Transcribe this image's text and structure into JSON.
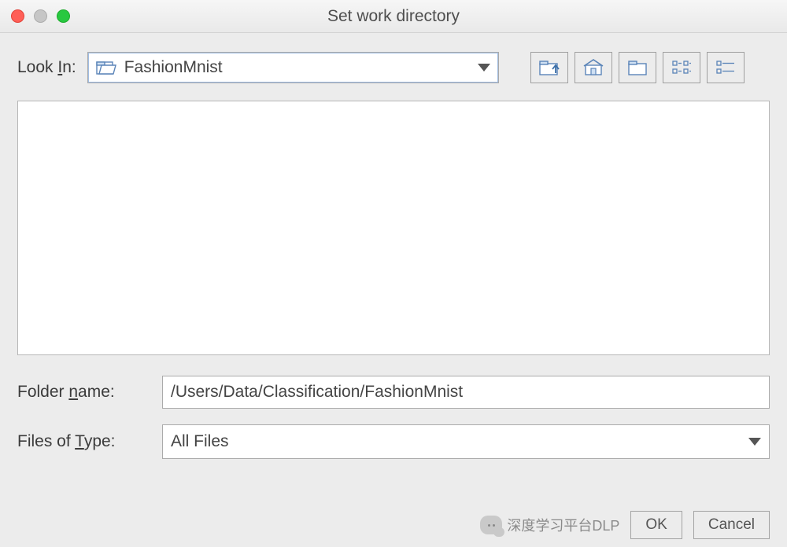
{
  "window": {
    "title": "Set work directory"
  },
  "toolbar": {
    "look_in_label_pre": "Look ",
    "look_in_label_u": "I",
    "look_in_label_post": "n:",
    "current_folder": "FashionMnist"
  },
  "file_list": {
    "items": []
  },
  "form": {
    "folder_name_label_pre": "Folder ",
    "folder_name_label_u": "n",
    "folder_name_label_post": "ame:",
    "folder_name_value": "/Users/Data/Classification/FashionMnist",
    "files_of_type_label_pre": "Files of ",
    "files_of_type_label_u": "T",
    "files_of_type_label_post": "ype:",
    "files_of_type_value": "All Files"
  },
  "footer": {
    "watermark": "深度学习平台DLP",
    "ok": "OK",
    "cancel": "Cancel"
  }
}
